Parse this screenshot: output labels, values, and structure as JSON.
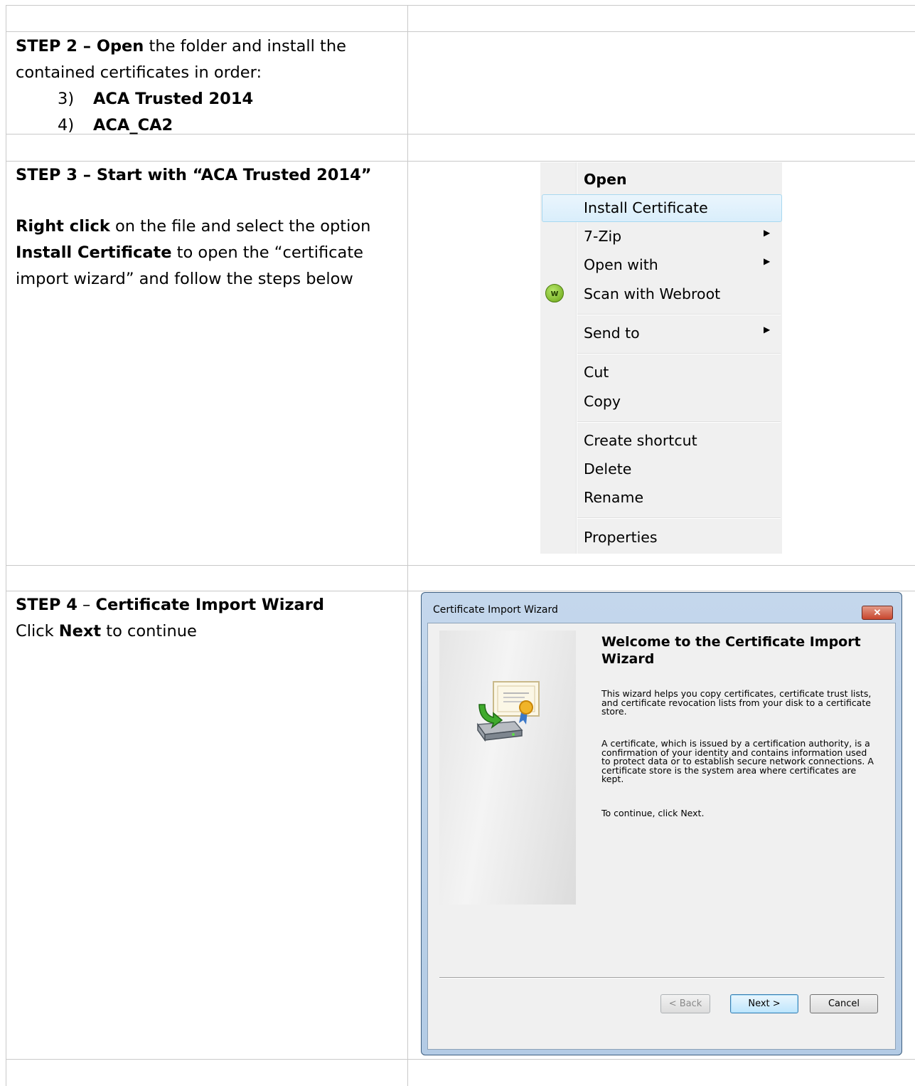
{
  "step2": {
    "prefix": "STEP 2 – Open",
    "rest_line1": " the folder and install the",
    "line2": "contained certificates in order:",
    "items": [
      {
        "num": "3)",
        "label": "ACA Trusted 2014"
      },
      {
        "num": "4)",
        "label": "ACA_CA2"
      }
    ]
  },
  "step3": {
    "heading": "STEP 3 – Start with “ACA Trusted 2014”",
    "right_click": "Right click",
    "rest_line1": " on the file and select the option",
    "install_bold": "Install Certificate",
    "rest_line2": " to open the “certificate",
    "line3": "import wizard” and follow the steps below"
  },
  "context_menu": {
    "items": [
      {
        "label": "Open",
        "bold": true
      },
      {
        "label": "Install Certificate",
        "selected": true
      },
      {
        "label": "7-Zip",
        "submenu": true
      },
      {
        "label": "Open with",
        "submenu": true
      },
      {
        "label": "Scan with Webroot",
        "icon": "webroot-icon"
      },
      {
        "label": "Send to",
        "submenu": true
      },
      {
        "label": "Cut"
      },
      {
        "label": "Copy"
      },
      {
        "label": "Create shortcut"
      },
      {
        "label": "Delete"
      },
      {
        "label": "Rename"
      },
      {
        "label": "Properties"
      }
    ]
  },
  "step4": {
    "heading_step": "STEP 4",
    "heading_dash": " – ",
    "heading_title": "Certificate Import Wizard",
    "click": "Click ",
    "next_bold": "Next",
    "continue": " to continue"
  },
  "wizard": {
    "window_title": "Certificate Import Wizard",
    "heading": "Welcome to the Certificate Import Wizard",
    "para1": "This wizard helps you copy certificates, certificate trust lists, and certificate revocation lists from your disk to a certificate store.",
    "para2": "A certificate, which is issued by a certification authority, is a confirmation of your identity and contains information used to protect data or to establish secure network connections. A certificate store is the system area where certificates are kept.",
    "para3": "To continue, click Next.",
    "back_label": "< Back",
    "next_label": "Next >",
    "cancel_label": "Cancel"
  },
  "colors": {
    "grid": "#c9c9c9",
    "menu_bg": "#f0f0f0",
    "selection": "#d9eefb"
  }
}
